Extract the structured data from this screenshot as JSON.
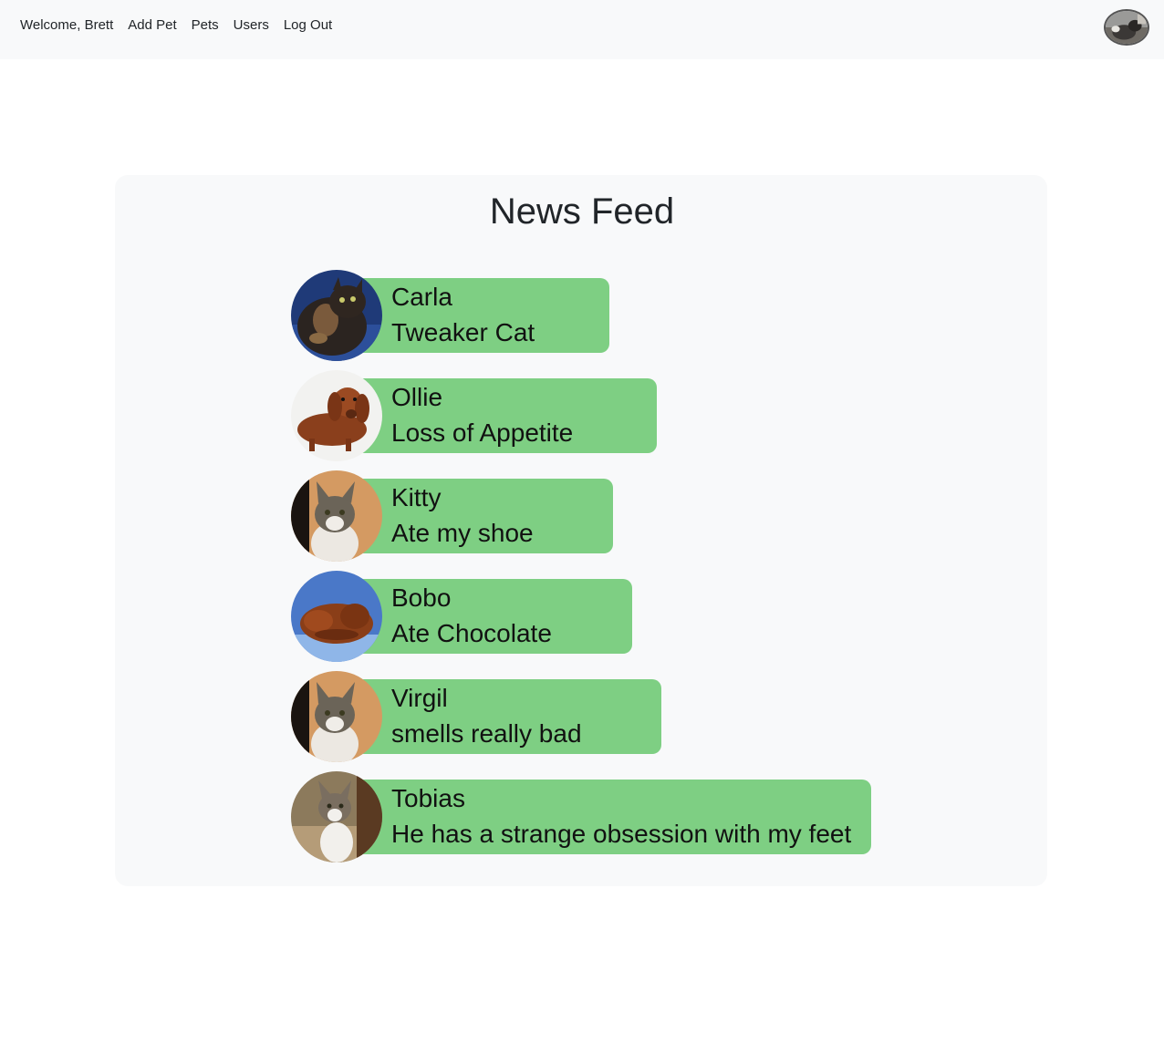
{
  "nav": {
    "welcome": "Welcome, Brett",
    "add_pet": "Add Pet",
    "pets": "Pets",
    "users": "Users",
    "log_out": "Log Out",
    "avatar_icon": "user-avatar-icon"
  },
  "feed": {
    "title": "News Feed",
    "items": [
      {
        "name": "Carla",
        "note": "Tweaker Cat",
        "photo": "tortoiseshell-cat-photo"
      },
      {
        "name": "Ollie",
        "note": "Loss of Appetite",
        "photo": "dachshund-photo"
      },
      {
        "name": "Kitty",
        "note": "Ate my shoe",
        "photo": "tabby-cat-photo"
      },
      {
        "name": "Bobo",
        "note": "Ate Chocolate",
        "photo": "sleeping-dog-photo"
      },
      {
        "name": "Virgil",
        "note": "smells really bad",
        "photo": "tabby-cat-photo"
      },
      {
        "name": "Tobias",
        "note": "He has a strange obsession with my feet",
        "photo": "tabby-white-cat-photo"
      }
    ]
  },
  "colors": {
    "navbar_bg": "#f8f9fa",
    "card_bg": "#f8f9fa",
    "bubble_green": "#7ecf83",
    "text_dark": "#212529"
  }
}
